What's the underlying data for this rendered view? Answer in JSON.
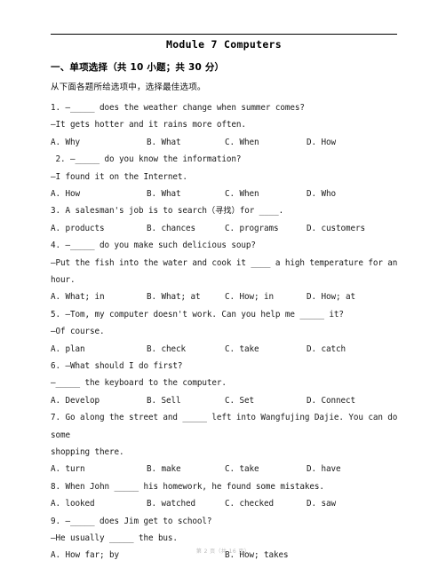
{
  "document": {
    "title": "Module 7 Computers",
    "section_heading": "一、单项选择（共 10 小题；共 30 分）",
    "instruction": "从下面各题所给选项中，选择最佳选项。",
    "footer": "第 2 页（共 16 页）"
  },
  "questions": [
    {
      "number": "1",
      "lines": [
        "1. —_____ does the weather change when summer comes?",
        "—It gets hotter and it rains more often."
      ],
      "options": [
        "A. Why",
        "B. What",
        "C. When",
        "D. How"
      ],
      "layout": "four"
    },
    {
      "number": "2",
      "lines": [
        " 2. —_____ do you know the information?",
        "—I found it on the Internet."
      ],
      "options": [
        "A. How",
        "B. What",
        "C. When",
        "D. Who"
      ],
      "layout": "four"
    },
    {
      "number": "3",
      "lines": [
        "3. A salesman's job is to search（寻找）for ____."
      ],
      "options": [
        "A. products",
        "B. chances",
        "C. programs",
        "D. customers"
      ],
      "layout": "four"
    },
    {
      "number": "4",
      "lines": [
        "4. —_____ do you make such delicious soup?",
        "—Put the fish into the water and cook it ____ a high temperature for an hour."
      ],
      "options": [
        "A. What; in",
        "B. What; at",
        "C. How; in",
        "D. How; at"
      ],
      "layout": "four"
    },
    {
      "number": "5",
      "lines": [
        "5. —Tom, my computer doesn't work. Can you help me _____ it?",
        "—Of course."
      ],
      "options": [
        "A. plan",
        "B. check",
        "C. take",
        "D. catch"
      ],
      "layout": "four"
    },
    {
      "number": "6",
      "lines": [
        "6. —What should I do first?",
        "—_____ the keyboard to the computer."
      ],
      "options": [
        "A. Develop",
        "B. Sell",
        "C. Set",
        "D. Connect"
      ],
      "layout": "four"
    },
    {
      "number": "7",
      "lines": [
        "7. Go along the street and _____ left into Wangfujing Dajie. You can do some",
        "shopping there."
      ],
      "options": [
        "A. turn",
        "B. make",
        "C. take",
        "D. have"
      ],
      "layout": "four"
    },
    {
      "number": "8",
      "lines": [
        "8. When John _____ his homework, he found some mistakes."
      ],
      "options": [
        "A. looked",
        "B. watched",
        "C. checked",
        "D. saw"
      ],
      "layout": "four"
    },
    {
      "number": "9",
      "lines": [
        "9. —_____ does Jim get to school?",
        "—He usually _____ the bus."
      ],
      "options": [
        "A. How far; by",
        "B. How; takes"
      ],
      "layout": "wide"
    }
  ]
}
